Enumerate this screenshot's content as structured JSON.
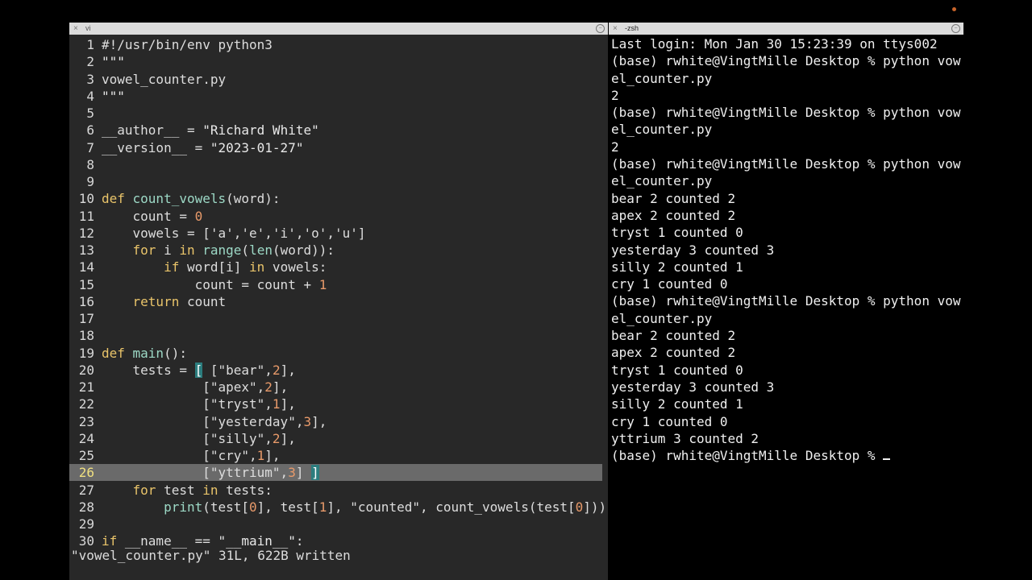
{
  "vi_window": {
    "title": "vi",
    "lines": [
      {
        "n": "1",
        "parts": [
          [
            "",
            "#!/usr/bin/env python3"
          ]
        ]
      },
      {
        "n": "2",
        "parts": [
          [
            "str",
            "\"\"\""
          ]
        ]
      },
      {
        "n": "3",
        "parts": [
          [
            "",
            "vowel_counter.py"
          ]
        ]
      },
      {
        "n": "4",
        "parts": [
          [
            "str",
            "\"\"\""
          ]
        ]
      },
      {
        "n": "5",
        "parts": []
      },
      {
        "n": "6",
        "parts": [
          [
            "",
            "__author__ = "
          ],
          [
            "str",
            "\"Richard White\""
          ]
        ]
      },
      {
        "n": "7",
        "parts": [
          [
            "",
            "__version__ = "
          ],
          [
            "str",
            "\"2023-01-27\""
          ]
        ]
      },
      {
        "n": "8",
        "parts": []
      },
      {
        "n": "9",
        "parts": []
      },
      {
        "n": "10",
        "parts": [
          [
            "kw",
            "def "
          ],
          [
            "fn",
            "count_vowels"
          ],
          [
            "",
            "(word):"
          ]
        ]
      },
      {
        "n": "11",
        "parts": [
          [
            "",
            "    count = "
          ],
          [
            "num",
            "0"
          ]
        ]
      },
      {
        "n": "12",
        "parts": [
          [
            "",
            "    vowels = ['a','e','i','o','u']"
          ]
        ]
      },
      {
        "n": "13",
        "parts": [
          [
            "",
            "    "
          ],
          [
            "kw",
            "for"
          ],
          [
            "",
            " i "
          ],
          [
            "kw",
            "in"
          ],
          [
            "",
            " "
          ],
          [
            "fn",
            "range"
          ],
          [
            "",
            "("
          ],
          [
            "fn",
            "len"
          ],
          [
            "",
            "(word)):"
          ]
        ]
      },
      {
        "n": "14",
        "parts": [
          [
            "",
            "        "
          ],
          [
            "kw",
            "if"
          ],
          [
            "",
            " word[i] "
          ],
          [
            "kw",
            "in"
          ],
          [
            "",
            " vowels:"
          ]
        ]
      },
      {
        "n": "15",
        "parts": [
          [
            "",
            "            count = count + "
          ],
          [
            "num",
            "1"
          ]
        ]
      },
      {
        "n": "16",
        "parts": [
          [
            "",
            "    "
          ],
          [
            "kw",
            "return"
          ],
          [
            "",
            " count"
          ]
        ]
      },
      {
        "n": "17",
        "parts": []
      },
      {
        "n": "18",
        "parts": []
      },
      {
        "n": "19",
        "parts": [
          [
            "kw",
            "def "
          ],
          [
            "fn",
            "main"
          ],
          [
            "",
            "():"
          ]
        ]
      },
      {
        "n": "20",
        "parts": [
          [
            "",
            "    tests = "
          ],
          [
            "bracket-hl",
            "["
          ],
          [
            "",
            " [\"bear\","
          ],
          [
            "num",
            "2"
          ],
          [
            "",
            "],"
          ]
        ]
      },
      {
        "n": "21",
        "parts": [
          [
            "",
            "             [\"apex\","
          ],
          [
            "num",
            "2"
          ],
          [
            "",
            "],"
          ]
        ]
      },
      {
        "n": "22",
        "parts": [
          [
            "",
            "             [\"tryst\","
          ],
          [
            "num",
            "1"
          ],
          [
            "",
            "],"
          ]
        ]
      },
      {
        "n": "23",
        "parts": [
          [
            "",
            "             [\"yesterday\","
          ],
          [
            "num",
            "3"
          ],
          [
            "",
            "],"
          ]
        ]
      },
      {
        "n": "24",
        "parts": [
          [
            "",
            "             [\"silly\","
          ],
          [
            "num",
            "2"
          ],
          [
            "",
            "],"
          ]
        ]
      },
      {
        "n": "25",
        "parts": [
          [
            "",
            "             [\"cry\","
          ],
          [
            "num",
            "1"
          ],
          [
            "",
            "],"
          ]
        ]
      },
      {
        "n": "26",
        "cursor": true,
        "parts": [
          [
            "",
            "             [\"yttrium\","
          ],
          [
            "num",
            "3"
          ],
          [
            "",
            "] "
          ],
          [
            "bracket-hl",
            "]"
          ]
        ]
      },
      {
        "n": "27",
        "parts": [
          [
            "",
            "    "
          ],
          [
            "kw",
            "for"
          ],
          [
            "",
            " test "
          ],
          [
            "kw",
            "in"
          ],
          [
            "",
            " tests:"
          ]
        ]
      },
      {
        "n": "28",
        "parts": [
          [
            "",
            "        "
          ],
          [
            "fn",
            "print"
          ],
          [
            "",
            "(test["
          ],
          [
            "num",
            "0"
          ],
          [
            "",
            "], test["
          ],
          [
            "num",
            "1"
          ],
          [
            "",
            "], \"counted\", count_vowels(test["
          ],
          [
            "num",
            "0"
          ],
          [
            "",
            "]))"
          ]
        ]
      },
      {
        "n": "29",
        "parts": []
      },
      {
        "n": "30",
        "parts": [
          [
            "kw",
            "if"
          ],
          [
            "",
            " __name__ == "
          ],
          [
            "str",
            "\"__main__\""
          ],
          [
            "",
            ":"
          ]
        ]
      }
    ],
    "status_line": "\"vowel_counter.py\" 31L, 622B written"
  },
  "zsh_window": {
    "title": "-zsh",
    "lines": [
      "Last login: Mon Jan 30 15:23:39 on ttys002",
      "(base) rwhite@VingtMille Desktop % python vow",
      "el_counter.py",
      "2",
      "(base) rwhite@VingtMille Desktop % python vow",
      "el_counter.py",
      "2",
      "(base) rwhite@VingtMille Desktop % python vow",
      "el_counter.py",
      "bear 2 counted 2",
      "apex 2 counted 2",
      "tryst 1 counted 0",
      "yesterday 3 counted 3",
      "silly 2 counted 1",
      "cry 1 counted 0",
      "(base) rwhite@VingtMille Desktop % python vow",
      "el_counter.py",
      "bear 2 counted 2",
      "apex 2 counted 2",
      "tryst 1 counted 0",
      "yesterday 3 counted 3",
      "silly 2 counted 1",
      "cry 1 counted 0",
      "yttrium 3 counted 2"
    ],
    "prompt": "(base) rwhite@VingtMille Desktop % "
  },
  "icons": {
    "close": "×",
    "options": "⊖"
  },
  "colors": {
    "keyword": "#e9c46a",
    "function": "#9dd9c6",
    "number": "#e89a6a",
    "bracket_highlight": "#2c7d7e"
  }
}
